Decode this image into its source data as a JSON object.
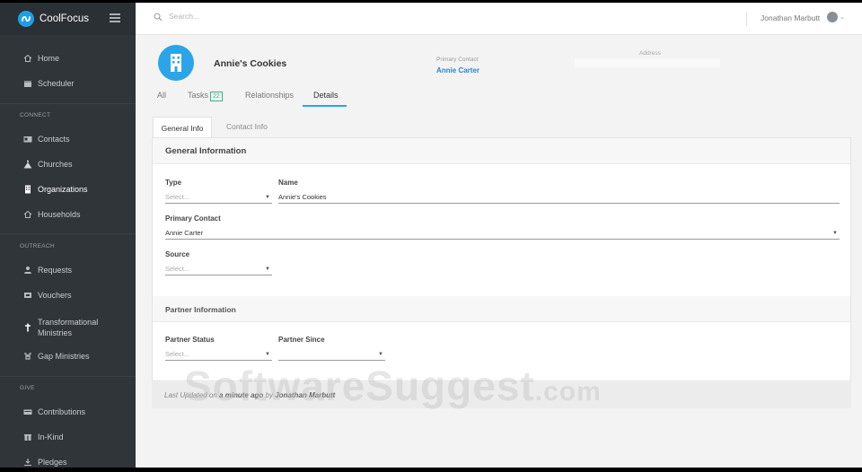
{
  "app": {
    "name": "CoolFocus"
  },
  "sidebar": {
    "items": [
      {
        "label": "Home",
        "icon": "home-icon"
      },
      {
        "label": "Scheduler",
        "icon": "calendar-icon"
      },
      {
        "label": "Contacts",
        "icon": "contacts-card-icon"
      },
      {
        "label": "Churches",
        "icon": "church-icon"
      },
      {
        "label": "Organizations",
        "icon": "building-icon",
        "active": true
      },
      {
        "label": "Households",
        "icon": "house-icon"
      },
      {
        "label": "Requests",
        "icon": "hand-request-icon"
      },
      {
        "label": "Vouchers",
        "icon": "voucher-icon"
      },
      {
        "label": "Transformational Ministries",
        "line1": "Transformational",
        "line2": "Ministries",
        "icon": "cross-icon"
      },
      {
        "label": "Gap Ministries",
        "icon": "gap-icon"
      },
      {
        "label": "Contributions",
        "icon": "contributions-icon"
      },
      {
        "label": "In-Kind",
        "icon": "gift-icon"
      },
      {
        "label": "Pledges",
        "icon": "pledge-icon"
      }
    ],
    "sections": {
      "connect": "CONNECT",
      "outreach": "OUTREACH",
      "give": "GIVE"
    }
  },
  "topbar": {
    "search_placeholder": "Search...",
    "user_name": "Jonathan Marbutt"
  },
  "header": {
    "org_name": "Annie's Cookies",
    "primary_contact_label": "Primary Contact",
    "primary_contact_value": "Annie Carter",
    "address_label": "Address"
  },
  "tabs": {
    "all": "All",
    "tasks": "Tasks",
    "tasks_count": "22",
    "relationships": "Relationships",
    "details": "Details"
  },
  "subtabs": {
    "general": "General Info",
    "contact": "Contact Info"
  },
  "general": {
    "title": "General Information",
    "type_label": "Type",
    "type_placeholder": "Select...",
    "name_label": "Name",
    "name_value": "Annie's Cookies",
    "primary_contact_label": "Primary Contact",
    "primary_contact_value": "Annie Carter",
    "source_label": "Source",
    "source_placeholder": "Select..."
  },
  "partner": {
    "title": "Partner Information",
    "status_label": "Partner Status",
    "status_placeholder": "Select...",
    "since_label": "Partner Since"
  },
  "footer": {
    "prefix": "Last Updated on",
    "when": "a minute ago",
    "by": "by",
    "who": "Jonathan Marbutt"
  },
  "watermark": {
    "main": "SoftwareSuggest",
    "suffix": ".com"
  },
  "colors": {
    "accent": "#2ba4e8",
    "sidebar": "#30353a",
    "badge": "#2fb68a"
  }
}
